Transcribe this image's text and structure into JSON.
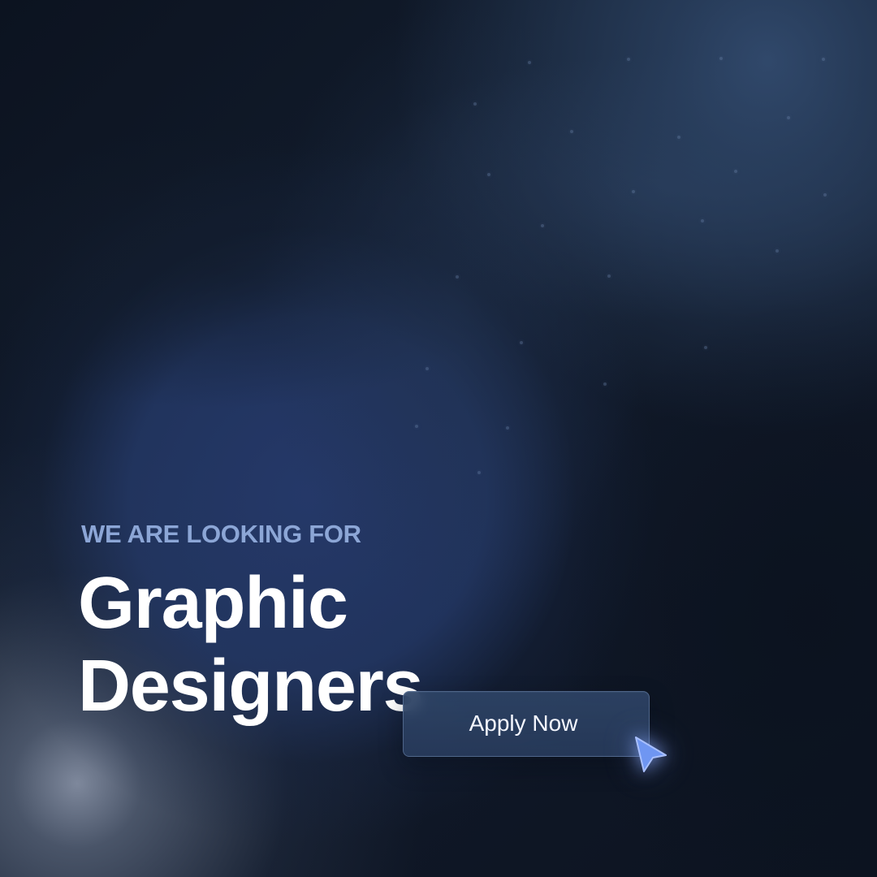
{
  "banner": {
    "eyebrow": "WE ARE LOOKING FOR",
    "headline_lines": [
      "Graphic",
      "Designers"
    ],
    "cta_label": "Apply Now"
  },
  "icons": {
    "cursor": "pointer-cursor-icon"
  },
  "colors": {
    "background": "#0e1624",
    "accent_text": "#8ca6d6",
    "headline_text": "#ffffff",
    "button_fill": "#2e4466",
    "cursor": "#6f96f2"
  }
}
